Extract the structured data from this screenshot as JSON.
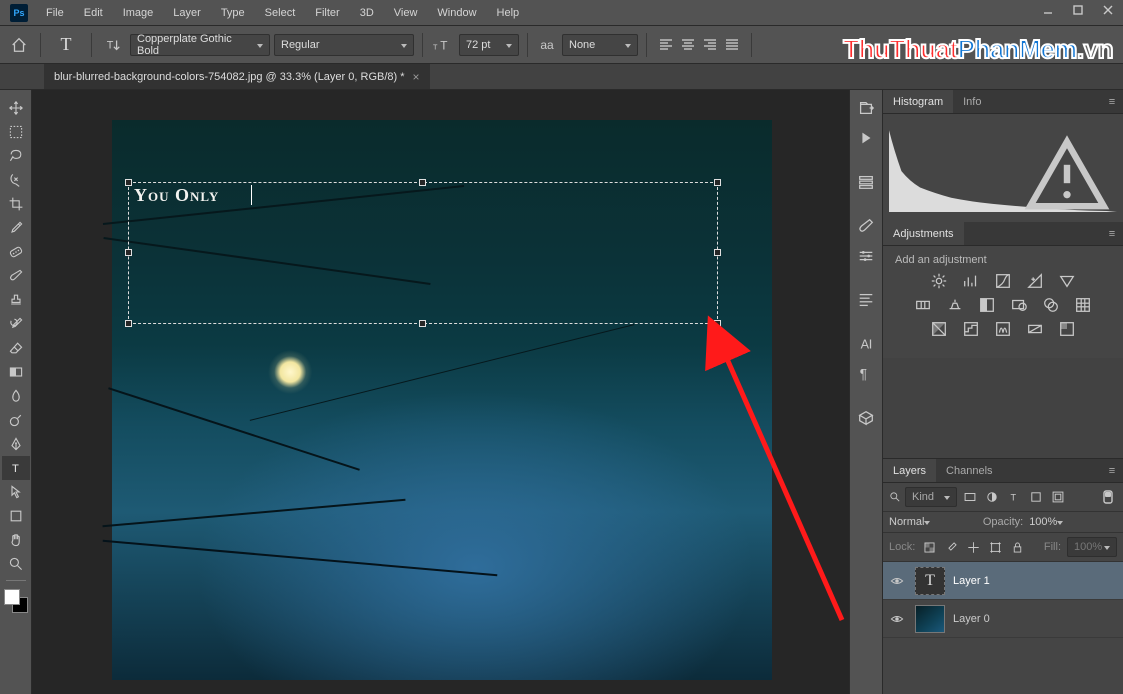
{
  "app": {
    "logo": "Ps"
  },
  "menu": [
    "File",
    "Edit",
    "Image",
    "Layer",
    "Type",
    "Select",
    "Filter",
    "3D",
    "View",
    "Window",
    "Help"
  ],
  "options": {
    "font_family": "Copperplate Gothic Bold",
    "font_style": "Regular",
    "font_size": "72 pt",
    "antialias_label": "aa",
    "antialias_value": "None"
  },
  "document": {
    "tab_title": "blur-blurred-background-colors-754082.jpg @ 33.3% (Layer 0, RGB/8) *",
    "typed_text": "You Only"
  },
  "watermark": {
    "p1": "ThuThuat",
    "p2": "PhanMem",
    "p3": ".vn"
  },
  "panels": {
    "histogram_tabs": [
      "Histogram",
      "Info"
    ],
    "adjustments_tab": "Adjustments",
    "adjustments_hint": "Add an adjustment",
    "layers_tabs": [
      "Layers",
      "Channels"
    ],
    "layers_filter_label": "Kind",
    "blend_mode": "Normal",
    "opacity_label": "Opacity:",
    "opacity_value": "100%",
    "lock_label": "Lock:",
    "fill_label": "Fill:",
    "fill_value": "100%",
    "layer_items": [
      {
        "name": "Layer 1",
        "type": "text"
      },
      {
        "name": "Layer 0",
        "type": "image"
      }
    ]
  },
  "icons": {
    "home": "home-icon",
    "orient": "text-orientation-icon",
    "size": "font-size-icon",
    "align_l": "align-left-icon",
    "align_c": "align-center-icon",
    "align_r": "align-right-icon",
    "align_j": "align-justify-icon",
    "tool_move": "move-tool",
    "tool_marquee": "marquee-tool",
    "tool_lasso": "lasso-tool",
    "tool_wand": "wand-tool",
    "tool_crop": "crop-tool",
    "tool_eyedrop": "eyedropper-tool",
    "tool_heal": "heal-tool",
    "tool_brush": "brush-tool",
    "tool_stamp": "stamp-tool",
    "tool_history": "history-brush-tool",
    "tool_eraser": "eraser-tool",
    "tool_gradient": "gradient-tool",
    "tool_blur": "blur-tool",
    "tool_dodge": "dodge-tool",
    "tool_pen": "pen-tool",
    "tool_type": "type-tool",
    "tool_path": "path-select-tool",
    "tool_shape": "shape-tool",
    "tool_hand": "hand-tool",
    "tool_zoom": "zoom-tool"
  }
}
